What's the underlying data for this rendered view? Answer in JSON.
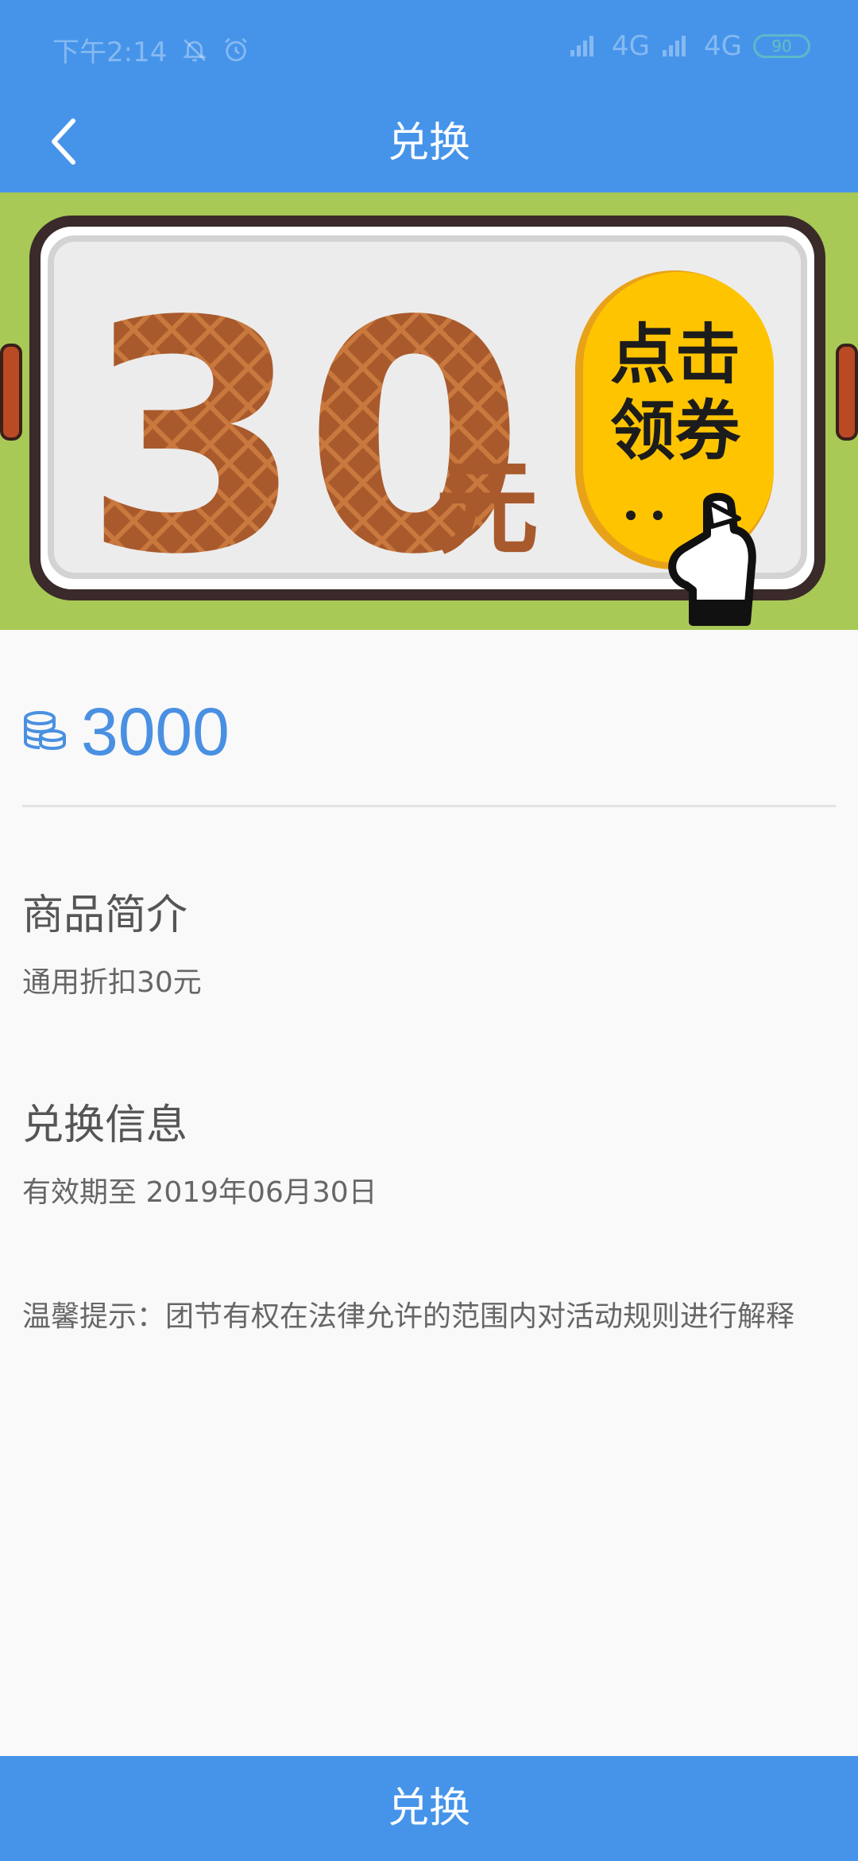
{
  "status_bar": {
    "time": "下午2:14",
    "network1": "4G",
    "network2": "4G",
    "battery": "90",
    "icons": [
      "bell-off-icon",
      "alarm-icon",
      "signal-icon",
      "signal-icon",
      "battery-icon"
    ]
  },
  "app_bar": {
    "title": "兑换",
    "back_icon": "chevron-left-icon"
  },
  "banner": {
    "amount": "30",
    "unit": "元",
    "cta_line1": "点击",
    "cta_line2": "领券",
    "colors": {
      "background": "#a8c956",
      "amount": "#a0522d",
      "cta": "#ffc107"
    }
  },
  "price": {
    "icon": "coins-icon",
    "value": "3000"
  },
  "product": {
    "title": "商品简介",
    "description": "通用折扣30元"
  },
  "exchange": {
    "title": "兑换信息",
    "validity": "有效期至 2019年06月30日"
  },
  "tip": "温馨提示：团节有权在法律允许的范围内对活动规则进行解释",
  "bottom_button": "兑换",
  "colors": {
    "primary": "#4694ea",
    "price": "#4a90e2"
  }
}
